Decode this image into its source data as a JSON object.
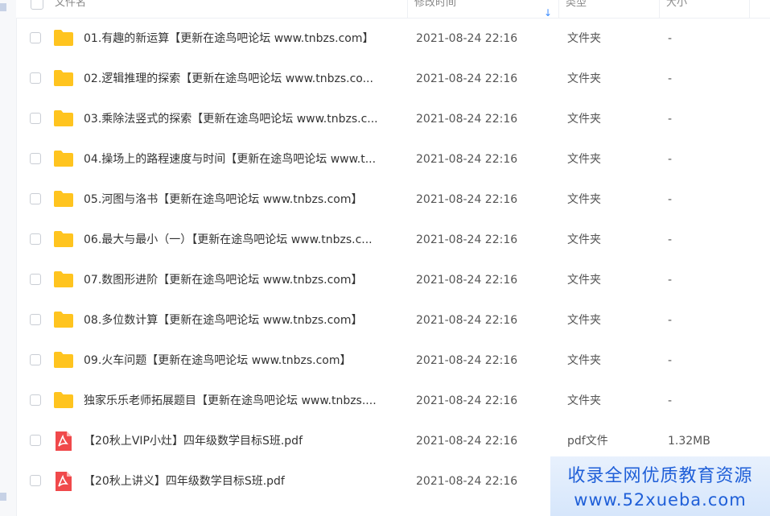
{
  "header": {
    "col_name": "文件名",
    "col_modified": "修改时间",
    "col_type": "类型",
    "col_size": "大小"
  },
  "colors": {
    "folder": "#ffc41f",
    "pdf": "#f0494b",
    "accent": "#3b8cff",
    "watermark_text": "#1f5fd8"
  },
  "files": [
    {
      "icon": "folder-icon",
      "name": "01.有趣的新运算【更新在途鸟吧论坛 www.tnbzs.com】",
      "modified": "2021-08-24 22:16",
      "type": "文件夹",
      "size": "-"
    },
    {
      "icon": "folder-icon",
      "name": "02.逻辑推理的探索【更新在途鸟吧论坛 www.tnbzs.co...",
      "modified": "2021-08-24 22:16",
      "type": "文件夹",
      "size": "-"
    },
    {
      "icon": "folder-icon",
      "name": "03.乘除法竖式的探索【更新在途鸟吧论坛 www.tnbzs.c...",
      "modified": "2021-08-24 22:16",
      "type": "文件夹",
      "size": "-"
    },
    {
      "icon": "folder-icon",
      "name": "04.操场上的路程速度与时间【更新在途鸟吧论坛 www.t...",
      "modified": "2021-08-24 22:16",
      "type": "文件夹",
      "size": "-"
    },
    {
      "icon": "folder-icon",
      "name": "05.河图与洛书【更新在途鸟吧论坛 www.tnbzs.com】",
      "modified": "2021-08-24 22:16",
      "type": "文件夹",
      "size": "-"
    },
    {
      "icon": "folder-icon",
      "name": "06.最大与最小（一）【更新在途鸟吧论坛 www.tnbzs.c...",
      "modified": "2021-08-24 22:16",
      "type": "文件夹",
      "size": "-"
    },
    {
      "icon": "folder-icon",
      "name": "07.数图形进阶【更新在途鸟吧论坛 www.tnbzs.com】",
      "modified": "2021-08-24 22:16",
      "type": "文件夹",
      "size": "-"
    },
    {
      "icon": "folder-icon",
      "name": "08.多位数计算【更新在途鸟吧论坛 www.tnbzs.com】",
      "modified": "2021-08-24 22:16",
      "type": "文件夹",
      "size": "-"
    },
    {
      "icon": "folder-icon",
      "name": "09.火车问题【更新在途鸟吧论坛 www.tnbzs.com】",
      "modified": "2021-08-24 22:16",
      "type": "文件夹",
      "size": "-"
    },
    {
      "icon": "folder-icon",
      "name": "独家乐乐老师拓展题目【更新在途鸟吧论坛 www.tnbzs....",
      "modified": "2021-08-24 22:16",
      "type": "文件夹",
      "size": "-"
    },
    {
      "icon": "pdf-icon",
      "name": "【20秋上VIP小灶】四年级数学目标S班.pdf",
      "modified": "2021-08-24 22:16",
      "type": "pdf文件",
      "size": "1.32MB"
    },
    {
      "icon": "pdf-icon",
      "name": "【20秋上讲义】四年级数学目标S班.pdf",
      "modified": "2021-08-24 22:16",
      "type": "",
      "size": ""
    }
  ],
  "watermark": {
    "line1": "收录全网优质教育资源",
    "line2": "www.52xueba.com"
  }
}
